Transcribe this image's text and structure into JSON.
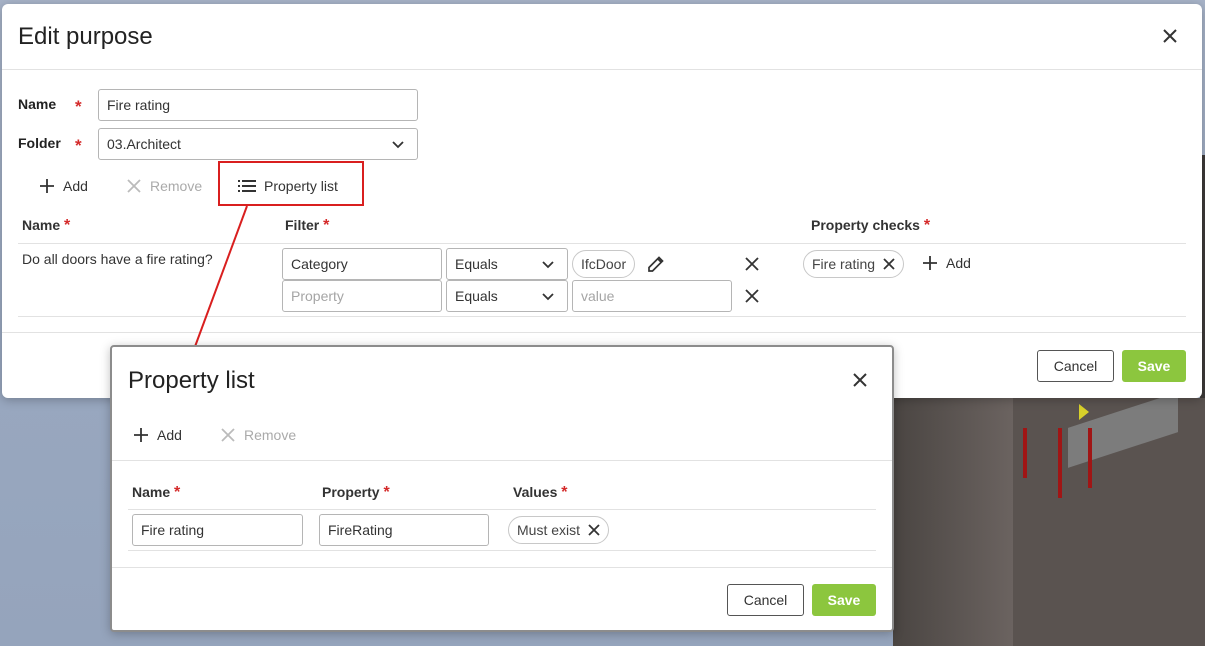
{
  "edit_purpose": {
    "title": "Edit purpose",
    "name_label": "Name",
    "name_value": "Fire rating",
    "folder_label": "Folder",
    "folder_value": "03.Architect",
    "toolbar": {
      "add": "Add",
      "remove": "Remove",
      "property_list": "Property list"
    },
    "table": {
      "col_name": "Name",
      "col_filter": "Filter",
      "col_property_checks": "Property checks",
      "rows": [
        {
          "name": "Do all doors have a fire rating?",
          "filters": [
            {
              "property": "Category",
              "operator": "Equals",
              "value": "IfcDoor",
              "property_placeholder": "",
              "value_placeholder": ""
            },
            {
              "property": "",
              "property_placeholder": "Property",
              "operator": "Equals",
              "value": "",
              "value_placeholder": "value"
            }
          ],
          "property_checks": [
            "Fire rating"
          ],
          "add_check_label": "Add"
        }
      ]
    },
    "cancel": "Cancel",
    "save": "Save"
  },
  "property_list": {
    "title": "Property list",
    "toolbar": {
      "add": "Add",
      "remove": "Remove"
    },
    "table": {
      "col_name": "Name",
      "col_property": "Property",
      "col_values": "Values",
      "rows": [
        {
          "name": "Fire rating",
          "property": "FireRating",
          "values": [
            "Must exist"
          ]
        }
      ]
    },
    "cancel": "Cancel",
    "save": "Save"
  },
  "colors": {
    "accent_save": "#8cc63e",
    "required_star": "#d42a2a",
    "highlight": "#d91f1f"
  }
}
